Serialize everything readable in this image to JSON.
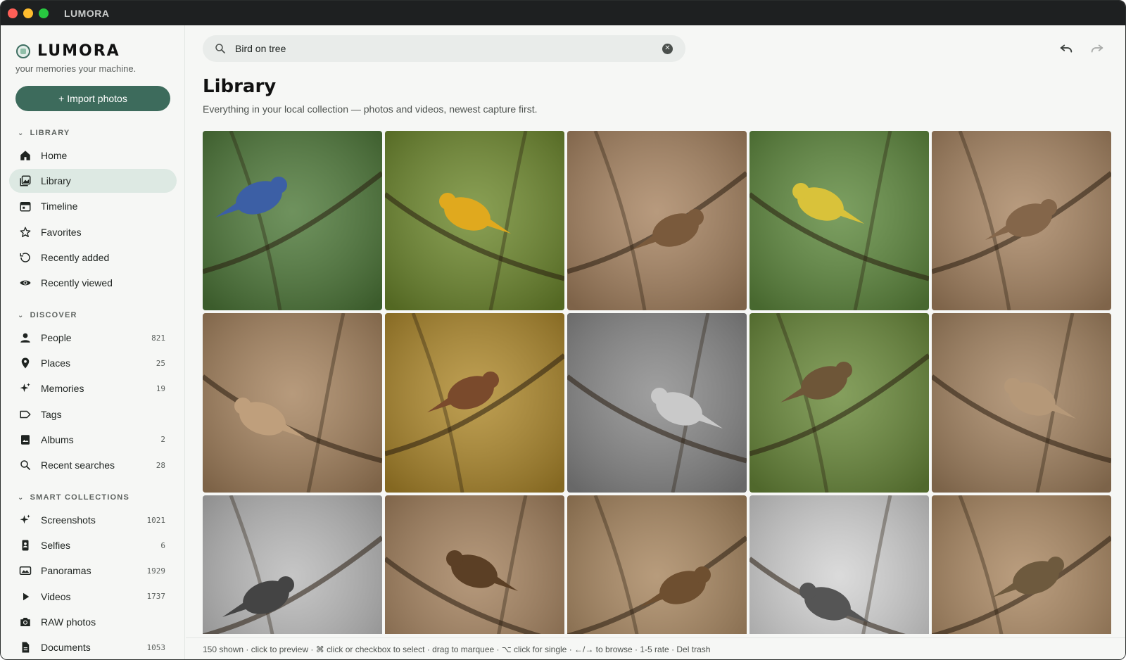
{
  "window": {
    "title": "LUMORA"
  },
  "brand": {
    "name": "LUMORA",
    "tagline": "your memories your machine."
  },
  "import_label": "+ Import photos",
  "sections": {
    "library": "LIBRARY",
    "discover": "DISCOVER",
    "smart": "SMART COLLECTIONS"
  },
  "library_items": [
    {
      "label": "Home",
      "icon": "home-icon"
    },
    {
      "label": "Library",
      "icon": "photo-library-icon",
      "active": true
    },
    {
      "label": "Timeline",
      "icon": "calendar-icon"
    },
    {
      "label": "Favorites",
      "icon": "star-icon"
    },
    {
      "label": "Recently added",
      "icon": "history-icon"
    },
    {
      "label": "Recently viewed",
      "icon": "eye-icon"
    }
  ],
  "discover_items": [
    {
      "label": "People",
      "count": "821",
      "icon": "person-icon"
    },
    {
      "label": "Places",
      "count": "25",
      "icon": "pin-icon"
    },
    {
      "label": "Memories",
      "count": "19",
      "icon": "sparkle-icon"
    },
    {
      "label": "Tags",
      "count": "",
      "icon": "tag-icon"
    },
    {
      "label": "Albums",
      "count": "2",
      "icon": "album-icon"
    },
    {
      "label": "Recent searches",
      "count": "28",
      "icon": "search-icon"
    }
  ],
  "smart_items": [
    {
      "label": "Screenshots",
      "count": "1021",
      "icon": "sparkle-icon"
    },
    {
      "label": "Selfies",
      "count": "6",
      "icon": "phone-icon"
    },
    {
      "label": "Panoramas",
      "count": "1929",
      "icon": "panorama-icon"
    },
    {
      "label": "Videos",
      "count": "1737",
      "icon": "play-icon"
    },
    {
      "label": "RAW photos",
      "count": "",
      "icon": "camera-icon"
    },
    {
      "label": "Documents",
      "count": "1053",
      "icon": "document-icon"
    }
  ],
  "search": {
    "value": "Bird on tree"
  },
  "page": {
    "title": "Library",
    "subtitle": "Everything in your local collection — photos and videos, newest capture first."
  },
  "photos": [
    {
      "tone": "#4f7a3a",
      "bird": "#3c5fa5"
    },
    {
      "tone": "#6f8a2e",
      "bird": "#e0a91e"
    },
    {
      "tone": "#a88461",
      "bird": "#7a5a3c"
    },
    {
      "tone": "#5f8a3e",
      "bird": "#d9c23a"
    },
    {
      "tone": "#a98663",
      "bird": "#84664a"
    },
    {
      "tone": "#a7845f",
      "bird": "#bf9f7c"
    },
    {
      "tone": "#b08a2c",
      "bird": "#7a4a2c"
    },
    {
      "tone": "#8a8a8a",
      "bird": "#c9c9c9"
    },
    {
      "tone": "#6a8a3a",
      "bird": "#6e5638"
    },
    {
      "tone": "#a58461",
      "bird": "#b59878"
    },
    {
      "tone": "#b9b9b9",
      "bird": "#444444"
    },
    {
      "tone": "#a5825e",
      "bird": "#5b3f25"
    },
    {
      "tone": "#a8865f",
      "bird": "#6e4f30"
    },
    {
      "tone": "#d3d3d3",
      "bird": "#555555"
    },
    {
      "tone": "#ab8862",
      "bird": "#6e5a3e"
    }
  ],
  "status": "150 shown · click to preview · ⌘ click or checkbox to select · drag to marquee · ⌥ click for single · ←/→ to browse · 1-5 rate · Del trash"
}
